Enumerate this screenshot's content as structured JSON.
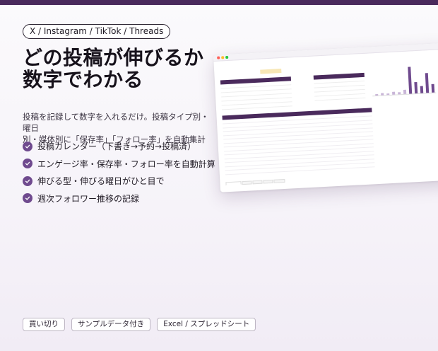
{
  "platforms": "X / Instagram / TikTok / Threads",
  "headline": {
    "line1": "どの投稿が伸びるか",
    "line2": "数字でわかる"
  },
  "description": {
    "line1": "投稿を記録して数字を入れるだけ。投稿タイプ別・曜日",
    "line2": "別・媒体別に「保存率」「フォロー率」を自動集計"
  },
  "features": [
    "投稿カレンダー（下書き→予約→投稿済）",
    "エンゲージ率・保存率・フォロー率を自動計算",
    "伸びる型・伸びる曜日がひと目で",
    "週次フォロワー推移の記録"
  ],
  "chips": [
    "買い切り",
    "サンプルデータ付き",
    "Excel / スプレッドシート"
  ],
  "colors": {
    "brand": "#4a2a5c",
    "accent": "#6f4a8e",
    "highlight": "#f7e7b5"
  },
  "icons": {
    "check": "check-circle-icon"
  }
}
